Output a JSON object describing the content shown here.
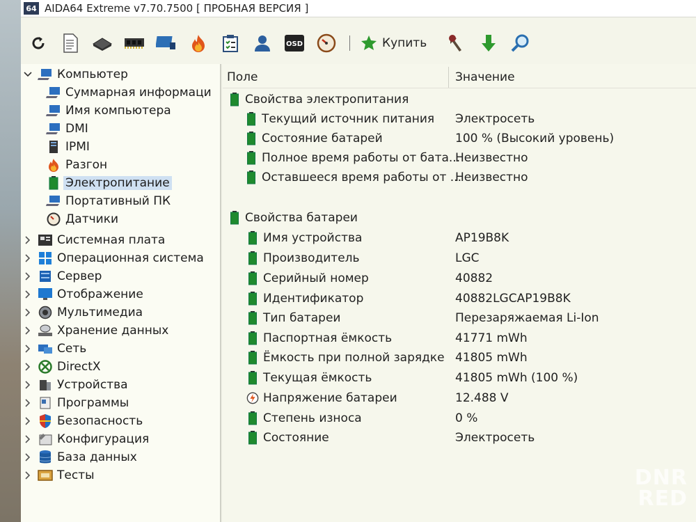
{
  "window": {
    "badge": "64",
    "title": "AIDA64 Extreme v7.70.7500  [ ПРОБНАЯ ВЕРСИЯ ]"
  },
  "toolbar": {
    "icons": [
      "refresh-icon",
      "report-icon",
      "motherboard-icon",
      "memory-icon",
      "network-icon",
      "overclock-icon",
      "checklist-icon",
      "user-icon",
      "osd-icon",
      "gauge-icon"
    ],
    "osd_label": "OSD",
    "buy_label": "Купить",
    "right_icons": [
      "tools-icon",
      "download-icon",
      "search-icon"
    ]
  },
  "tree": {
    "items": [
      {
        "label": "Компьютер",
        "level": 0,
        "expanded": true
      },
      {
        "label": "Суммарная информаци",
        "level": 1
      },
      {
        "label": "Имя компьютера",
        "level": 1
      },
      {
        "label": "DMI",
        "level": 1
      },
      {
        "label": "IPMI",
        "level": 1
      },
      {
        "label": "Разгон",
        "level": 1
      },
      {
        "label": "Электропитание",
        "level": 1,
        "selected": true
      },
      {
        "label": "Портативный ПК",
        "level": 1
      },
      {
        "label": "Датчики",
        "level": 1
      },
      {
        "label": "Системная плата",
        "level": 0
      },
      {
        "label": "Операционная система",
        "level": 0
      },
      {
        "label": "Сервер",
        "level": 0
      },
      {
        "label": "Отображение",
        "level": 0
      },
      {
        "label": "Мультимедиа",
        "level": 0
      },
      {
        "label": "Хранение данных",
        "level": 0
      },
      {
        "label": "Сеть",
        "level": 0
      },
      {
        "label": "DirectX",
        "level": 0
      },
      {
        "label": "Устройства",
        "level": 0
      },
      {
        "label": "Программы",
        "level": 0
      },
      {
        "label": "Безопасность",
        "level": 0
      },
      {
        "label": "Конфигурация",
        "level": 0
      },
      {
        "label": "База данных",
        "level": 0
      },
      {
        "label": "Тесты",
        "level": 0
      }
    ]
  },
  "details": {
    "columns": {
      "field": "Поле",
      "value": "Значение"
    },
    "group1": {
      "title": "Свойства электропитания",
      "rows": [
        {
          "field": "Текущий источник питания",
          "value": "Электросеть"
        },
        {
          "field": "Состояние батарей",
          "value": "100 % (Высокий уровень)"
        },
        {
          "field": "Полное время работы от бата...",
          "value": "Неизвестно"
        },
        {
          "field": "Оставшееся время работы от ...",
          "value": "Неизвестно"
        }
      ]
    },
    "group2": {
      "title": "Свойства батареи",
      "rows": [
        {
          "field": "Имя устройства",
          "value": "AP19B8K"
        },
        {
          "field": "Производитель",
          "value": "LGC"
        },
        {
          "field": "Серийный номер",
          "value": "40882"
        },
        {
          "field": "Идентификатор",
          "value": "40882LGCAP19B8K"
        },
        {
          "field": "Тип батареи",
          "value": "Перезаряжаемая Li-Ion"
        },
        {
          "field": "Паспортная ёмкость",
          "value": "41771 mWh"
        },
        {
          "field": "Ёмкость при полной зарядке",
          "value": "41805 mWh"
        },
        {
          "field": "Текущая ёмкость",
          "value": "41805 mWh  (100 %)"
        },
        {
          "field": "Напряжение батареи",
          "value": "12.488 V",
          "icon": "voltage-icon"
        },
        {
          "field": "Степень износа",
          "value": "0 %"
        },
        {
          "field": "Состояние",
          "value": "Электросеть"
        }
      ]
    }
  },
  "watermark": {
    "line1": "DNR",
    "line2": "RED"
  }
}
